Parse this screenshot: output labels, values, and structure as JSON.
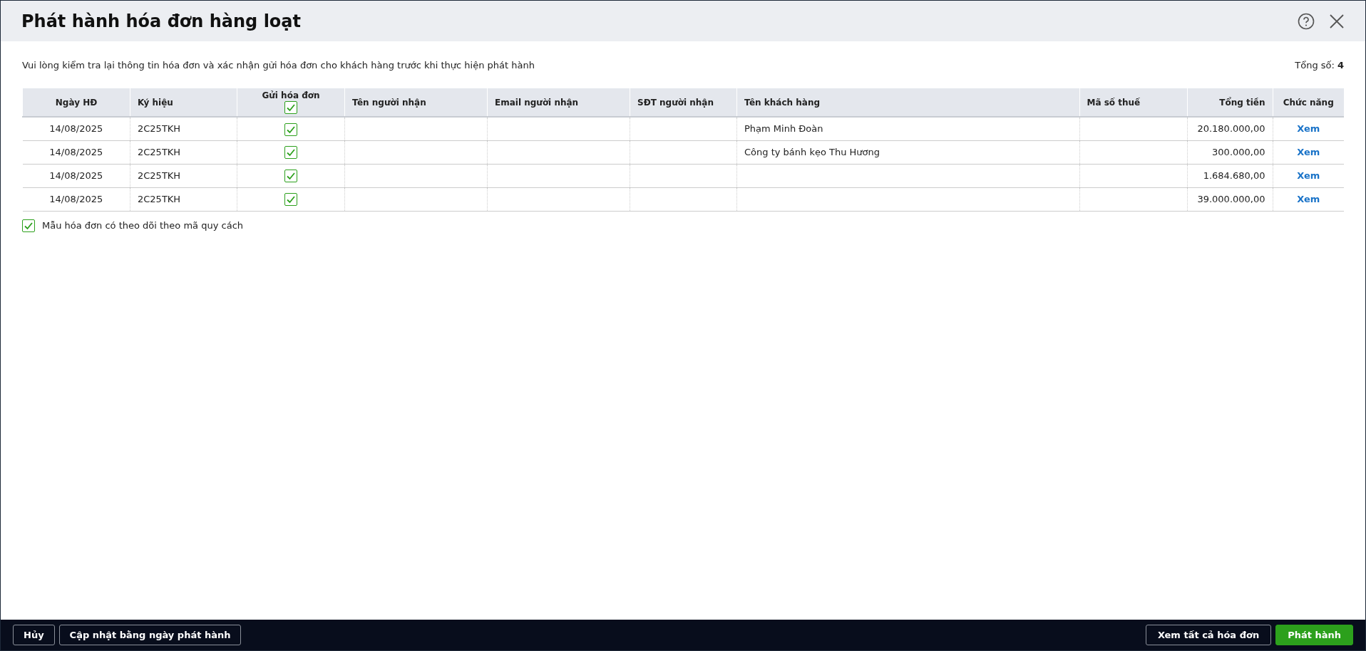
{
  "window": {
    "title": "Phát hành hóa đơn hàng loạt"
  },
  "description": "Vui lòng kiểm tra lại thông tin hóa đơn và xác nhận gửi hóa đơn cho khách hàng trước khi thực hiện phát hành",
  "total": {
    "label": "Tổng số:",
    "value": "4"
  },
  "table": {
    "columns": [
      {
        "label": "Ngày HĐ"
      },
      {
        "label": "Ký hiệu"
      },
      {
        "label": "Gửi hóa đơn",
        "checked": true
      },
      {
        "label": "Tên người nhận"
      },
      {
        "label": "Email người nhận"
      },
      {
        "label": "SĐT người nhận"
      },
      {
        "label": "Tên khách hàng"
      },
      {
        "label": "Mã số thuế"
      },
      {
        "label": "Tổng tiền"
      },
      {
        "label": "Chức năng"
      }
    ],
    "rows": [
      {
        "date": "14/08/2025",
        "symbol": "2C25TKH",
        "send": true,
        "customer": "Phạm Minh Đoàn",
        "total": "20.180.000,00",
        "action": "Xem"
      },
      {
        "date": "14/08/2025",
        "symbol": "2C25TKH",
        "send": true,
        "customer": "Công ty bánh kẹo Thu Hương",
        "total": "300.000,00",
        "action": "Xem"
      },
      {
        "date": "14/08/2025",
        "symbol": "2C25TKH",
        "send": true,
        "total": "1.684.680,00",
        "action": "Xem"
      },
      {
        "date": "14/08/2025",
        "symbol": "2C25TKH",
        "send": true,
        "total": "39.000.000,00",
        "action": "Xem"
      }
    ]
  },
  "option": {
    "label": "Mẫu hóa đơn có theo dõi theo mã quy cách",
    "checked": true
  },
  "footer": {
    "left_buttons": [
      "Hủy",
      "Cập nhật bằng ngày phát hành"
    ],
    "right_buttons": [
      {
        "label": "Xem tất cả hóa đơn",
        "kind": "secondary"
      },
      {
        "label": "Phát hành",
        "kind": "primary"
      }
    ]
  }
}
